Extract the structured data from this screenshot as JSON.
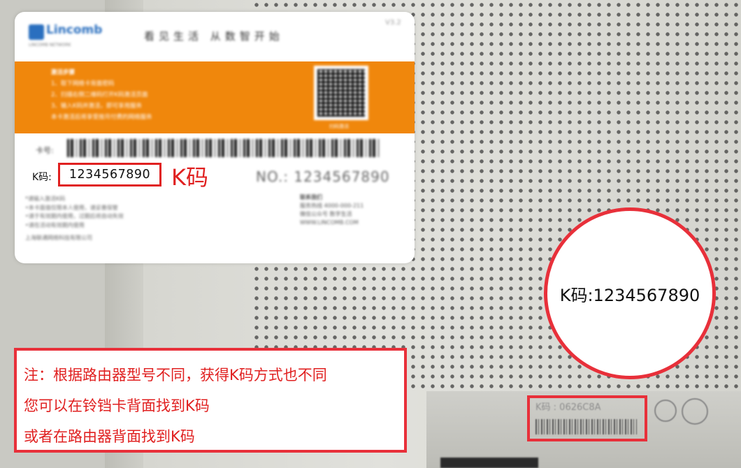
{
  "card": {
    "brand": "Lincomb",
    "brand_sub": "LINCOMB NETWORK",
    "slogan": "看见生活 从数智开始",
    "version": "V3.2",
    "steps_title": "激活步骤",
    "steps": [
      "1、取下网络卡背面密码",
      "2、扫描右侧二维码打开K码激活页面",
      "3、输入K码并激活，即可享用服务",
      "本卡激活后将享受按月付费的网络服务"
    ],
    "qr_caption": "扫码激活",
    "card_no_label": "卡号:",
    "k_code_label": "K码:",
    "k_code_value": "1234567890",
    "k_code_annotation": "K码",
    "serial_label": "NO.: 1234567890",
    "notes": [
      "*请输入激活K码",
      "•本卡面值仅限本人使用，请妥善保管",
      "•请于有效期内使用，过期后将自动失效",
      "•请在活动有效期内使用"
    ],
    "footer_left": "上海联通网络科技有限公司",
    "contact_title": "联系我们",
    "contact_lines": [
      "服务热线 4000-000-211",
      "微信公众号 数字生活",
      "WWW.LINCOMB.COM"
    ]
  },
  "magnifier": {
    "text": "K码:1234567890"
  },
  "router_label": {
    "k_text": "K码 : 0626C8A"
  },
  "note": {
    "lines": [
      "注：根据路由器型号不同，获得K码方式也不同",
      "您可以在铃铛卡背面找到K码",
      "或者在路由器背面找到K码"
    ]
  },
  "colors": {
    "accent_red": "#e02020",
    "card_orange": "#f0870c",
    "brand_blue": "#2a6fbf"
  }
}
